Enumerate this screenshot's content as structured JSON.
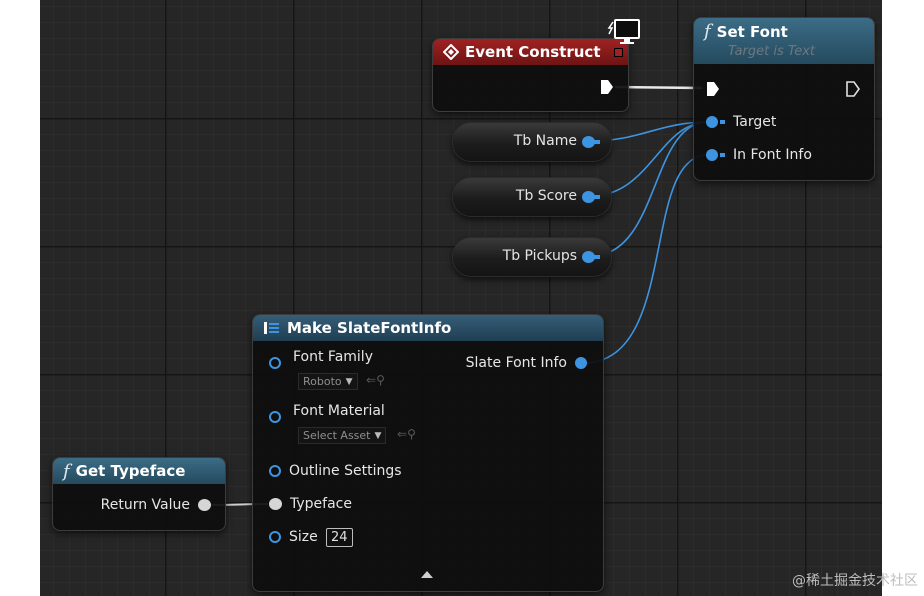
{
  "nodes": {
    "event_construct": {
      "title": "Event Construct"
    },
    "set_font": {
      "title": "Set Font",
      "subtitle": "Target is Text",
      "pin_target": "Target",
      "pin_in_font_info": "In Font Info"
    },
    "variables": [
      {
        "label": "Tb Name"
      },
      {
        "label": "Tb Score"
      },
      {
        "label": "Tb Pickups"
      }
    ],
    "make_slate_font_info": {
      "title": "Make SlateFontInfo",
      "pin_font_family": "Font Family",
      "font_family_value": "Roboto",
      "pin_font_material": "Font Material",
      "font_material_value": "Select Asset",
      "pin_outline_settings": "Outline Settings",
      "pin_typeface": "Typeface",
      "pin_size": "Size",
      "size_value": "24",
      "output_slate_font_info": "Slate Font Info"
    },
    "get_typeface": {
      "title": "Get Typeface",
      "pin_return_value": "Return Value"
    }
  },
  "colors": {
    "event_header": "#a02222",
    "function_header": "#3c6c86",
    "object_pin": "#3d94e0",
    "exec_pin": "#ffffff",
    "graph_bg": "#262626"
  },
  "watermark": "@稀土掘金技术社区"
}
